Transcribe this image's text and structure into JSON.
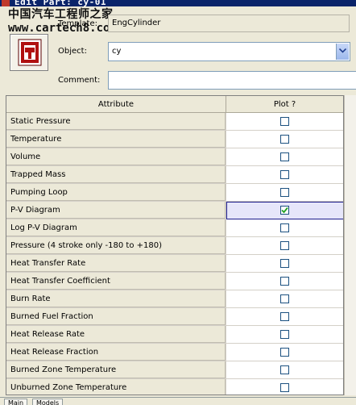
{
  "window": {
    "title": "Edit Part: cy-01"
  },
  "watermark": {
    "line1": "中国汽车工程师之家",
    "line2": "www.cartech8.com"
  },
  "template": {
    "label": "Template:",
    "value": "EngCylinder"
  },
  "object": {
    "label": "Object:",
    "value": "cy"
  },
  "comment": {
    "label": "Comment:",
    "value": ""
  },
  "table": {
    "headers": [
      "Attribute",
      "Plot ?"
    ],
    "rows": [
      {
        "label": "Static Pressure",
        "checked": false
      },
      {
        "label": "Temperature",
        "checked": false
      },
      {
        "label": "Volume",
        "checked": false
      },
      {
        "label": "Trapped Mass",
        "checked": false
      },
      {
        "label": "Pumping Loop",
        "checked": false
      },
      {
        "label": "P-V Diagram",
        "checked": true
      },
      {
        "label": "Log P-V Diagram",
        "checked": false
      },
      {
        "label": "Pressure  (4 stroke only -180 to +180)",
        "checked": false
      },
      {
        "label": "Heat Transfer Rate",
        "checked": false
      },
      {
        "label": "Heat Transfer Coefficient",
        "checked": false
      },
      {
        "label": "Burn Rate",
        "checked": false
      },
      {
        "label": "Burned Fuel Fraction",
        "checked": false
      },
      {
        "label": "Heat Release Rate",
        "checked": false
      },
      {
        "label": "Heat Release Fraction",
        "checked": false
      },
      {
        "label": "Burned Zone Temperature",
        "checked": false
      },
      {
        "label": "Unburned Zone Temperature",
        "checked": false
      }
    ],
    "selected_row": 5
  },
  "tabs": [
    "Main",
    "Models"
  ],
  "colors": {
    "title_bar": "#0a246a",
    "checkmark": "#21a121",
    "selection": "#e6e6fa"
  }
}
